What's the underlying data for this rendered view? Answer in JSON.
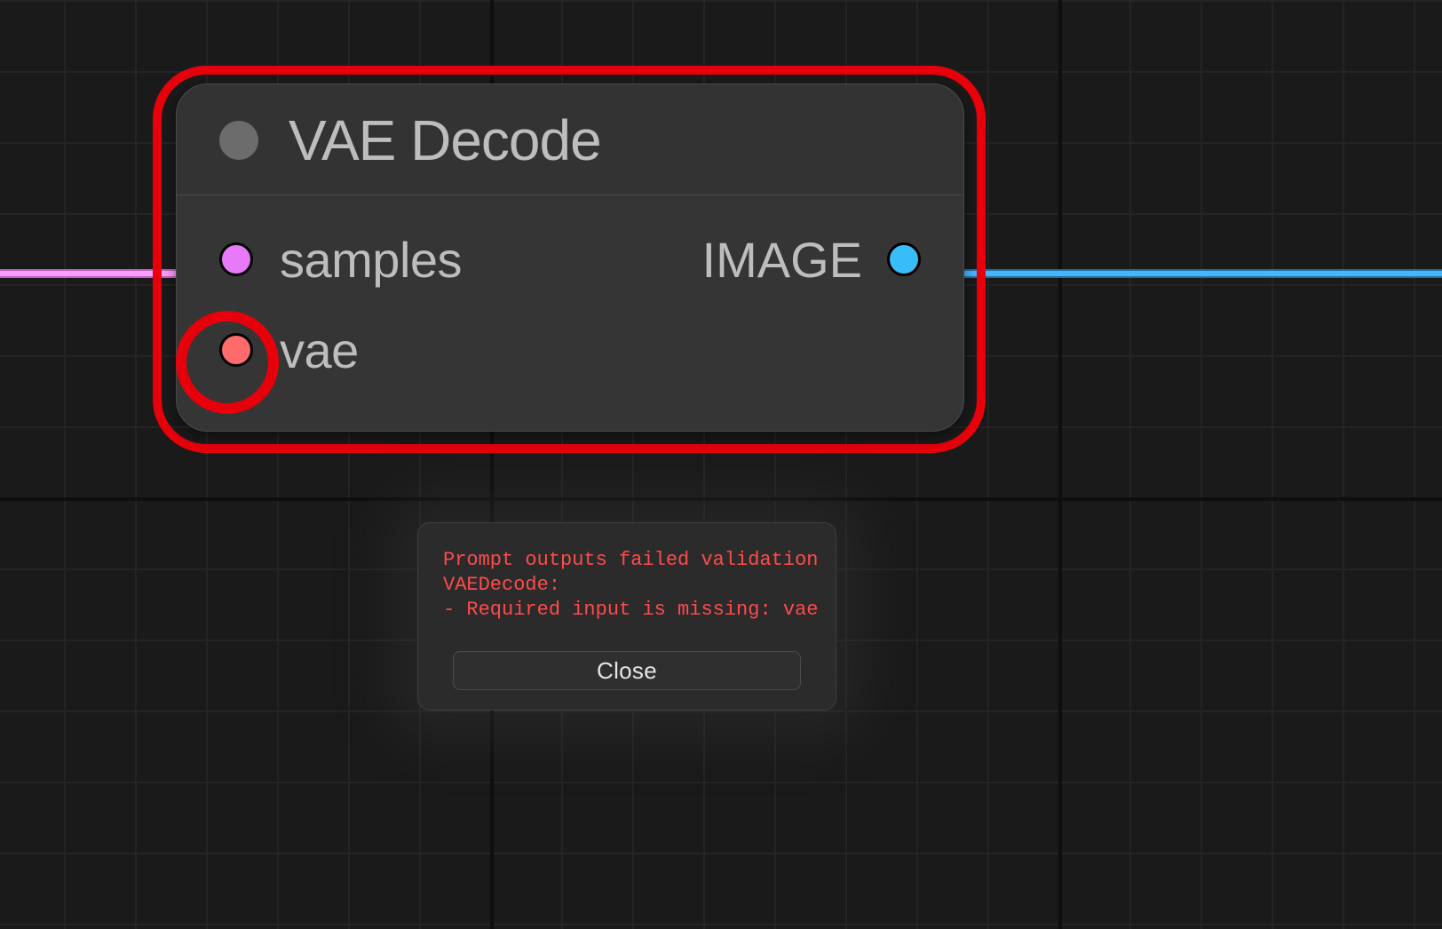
{
  "node": {
    "title": "VAE Decode",
    "inputs": {
      "samples": {
        "label": "samples",
        "color": "#e879f9",
        "connected": true
      },
      "vae": {
        "label": "vae",
        "color": "#ff6b6b",
        "connected": false,
        "error": true
      }
    },
    "outputs": {
      "image": {
        "label": "IMAGE",
        "color": "#38bdf8",
        "connected": true
      }
    }
  },
  "error_dialog": {
    "lines": [
      "Prompt outputs failed validation",
      "VAEDecode:",
      "- Required input is missing: vae"
    ],
    "close_label": "Close"
  },
  "colors": {
    "error_ring": "#e7000b"
  }
}
